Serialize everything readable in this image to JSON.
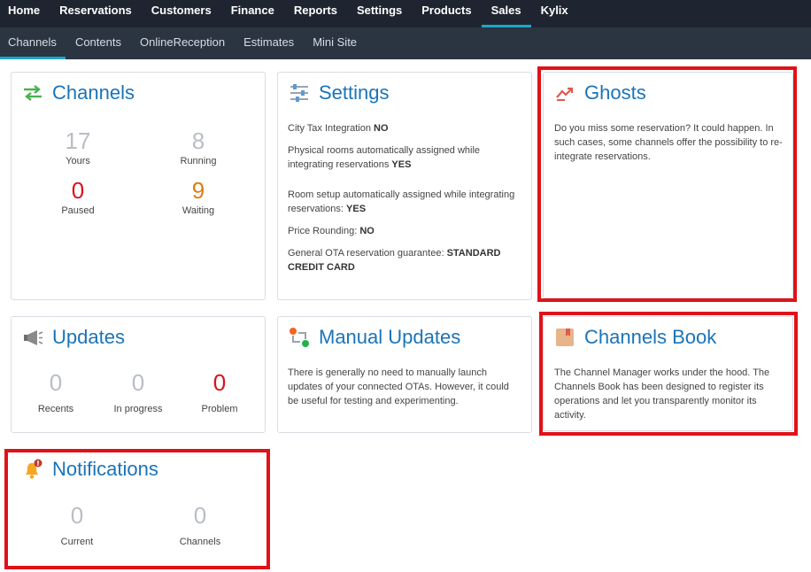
{
  "top_nav": [
    "Home",
    "Reservations",
    "Customers",
    "Finance",
    "Reports",
    "Settings",
    "Products",
    "Sales",
    "Kylix"
  ],
  "top_nav_active": "Sales",
  "sub_nav": [
    "Channels",
    "Contents",
    "OnlineReception",
    "Estimates",
    "Mini Site"
  ],
  "sub_nav_active": "Channels",
  "channels": {
    "title": "Channels",
    "yours": {
      "value": "17",
      "label": "Yours"
    },
    "running": {
      "value": "8",
      "label": "Running"
    },
    "paused": {
      "value": "0",
      "label": "Paused"
    },
    "waiting": {
      "value": "9",
      "label": "Waiting"
    }
  },
  "settings": {
    "title": "Settings",
    "lines": [
      {
        "text": "City Tax Integration ",
        "value": "NO"
      },
      {
        "text": "Physical rooms automatically assigned while integrating reservations ",
        "value": "YES"
      },
      {
        "text": "Room setup automatically assigned while integrating reservations: ",
        "value": "YES"
      },
      {
        "text": "Price Rounding: ",
        "value": "NO"
      },
      {
        "text": "General OTA reservation guarantee: ",
        "value": "STANDARD CREDIT CARD"
      }
    ]
  },
  "ghosts": {
    "title": "Ghosts",
    "text": "Do you miss some reservation? It could happen. In such cases, some channels offer the possibility to re-integrate reservations."
  },
  "updates": {
    "title": "Updates",
    "recents": {
      "value": "0",
      "label": "Recents"
    },
    "in_progress": {
      "value": "0",
      "label": "In progress"
    },
    "problem": {
      "value": "0",
      "label": "Problem"
    }
  },
  "manual_updates": {
    "title": "Manual Updates",
    "text": "There is generally no need to manually launch updates of your connected OTAs. However, it could be useful for testing and experimenting."
  },
  "channels_book": {
    "title": "Channels Book",
    "text": "The Channel Manager works under the hood. The Channels Book has been designed to register its operations and let you transparently monitor its activity."
  },
  "notifications": {
    "title": "Notifications",
    "current": {
      "value": "0",
      "label": "Current"
    },
    "channels": {
      "value": "0",
      "label": "Channels"
    }
  },
  "colors": {
    "accent": "#1aa7c9",
    "title_blue": "#1b74b8",
    "highlight_red": "#e01218",
    "stat_red": "#d9141a",
    "stat_orange": "#e07c10"
  }
}
